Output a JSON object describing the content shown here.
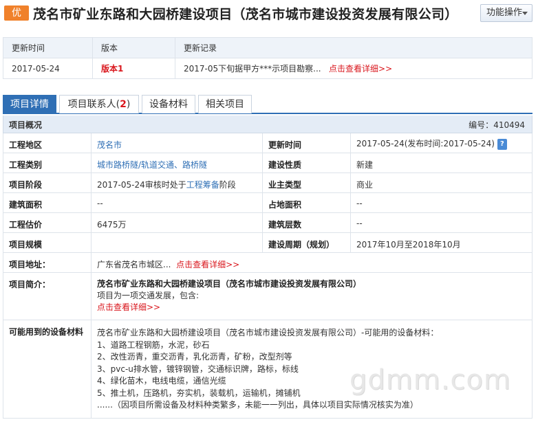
{
  "header": {
    "badge": "优",
    "title": "茂名市矿业东路和大园桥建设项目（茂名市城市建设投资发展有限公司）",
    "function_button": "功能操作"
  },
  "update_table": {
    "headers": [
      "更新时间",
      "版本",
      "更新记录"
    ],
    "row": {
      "date": "2017-05-24",
      "version": "版本1",
      "record": "2017-05下旬据甲方***示项目勘察...",
      "detail_link": "点击查看详细>>"
    }
  },
  "tabs": [
    {
      "label": "项目详情"
    },
    {
      "label": "项目联系人(",
      "count": "2",
      "suffix": ")"
    },
    {
      "label": "设备材料"
    },
    {
      "label": "相关项目"
    }
  ],
  "overview": {
    "title": "项目概况",
    "number_label": "编号：",
    "number": "410494"
  },
  "details": {
    "region_label": "工程地区",
    "region": "茂名市",
    "update_time_label": "更新时间",
    "update_time": "2017-05-24(发布时间:2017-05-24)",
    "category_label": "工程类别",
    "category": "城市路桥隧/轨道交通、路桥隧",
    "nature_label": "建设性质",
    "nature": "新建",
    "stage_label": "项目阶段",
    "stage_prefix": "2017-05-24审核时处于",
    "stage_link": "工程筹备",
    "stage_suffix": "阶段",
    "owner_type_label": "业主类型",
    "owner_type": "商业",
    "building_area_label": "建筑面积",
    "building_area": "--",
    "land_area_label": "占地面积",
    "land_area": "--",
    "estimate_label": "工程估价",
    "estimate": "6475万",
    "floors_label": "建筑层数",
    "floors": "--",
    "scale_label": "项目规模",
    "scale": "",
    "period_label": "建设周期（规划）",
    "period": "2017年10月至2018年10月",
    "address_label": "项目地址：",
    "address": "广东省茂名市城区...",
    "address_link": "点击查看详细>>",
    "intro_label": "项目简介：",
    "intro_title": "茂名市矿业东路和大园桥建设项目（茂名市城市建设投资发展有限公司）",
    "intro_text": "项目为一项交通发展，包含:",
    "intro_link": "点击查看详细>>",
    "materials_label": "可能用到的设备材料",
    "materials_intro": "茂名市矿业东路和大园桥建设项目（茂名市城市建设投资发展有限公司）-可能用的设备材料：",
    "materials": [
      "1、道路工程钢筋，水泥，砂石",
      "2、改性沥青，重交沥青，乳化沥青，矿粉，改型剂等",
      "3、pvc-u排水管，镀锌钢管，交通标识牌，路标，标线",
      "4、绿化苗木，电线电缆，通信光缆",
      "5、推土机，压路机，夯实机，装载机，运输机，摊铺机"
    ],
    "materials_note": "......（因项目所需设备及材料种类繁多，未能一一列出，具体以项目实际情况核实为准）"
  },
  "watermark": "gdmm.com"
}
